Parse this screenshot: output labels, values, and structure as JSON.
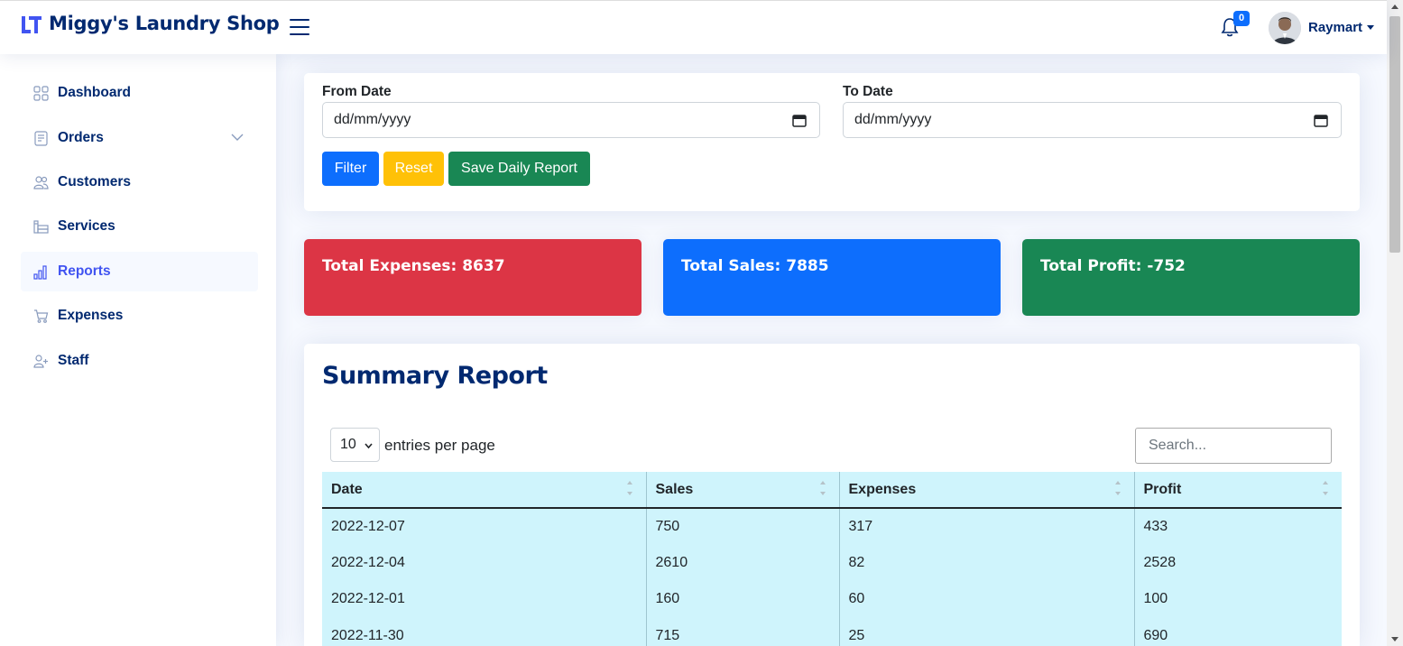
{
  "header": {
    "brand": "Miggy's Laundry Shop",
    "notification_count": "0",
    "user_name": "Raymart"
  },
  "sidebar": {
    "items": [
      {
        "label": "Dashboard",
        "icon": "grid-icon"
      },
      {
        "label": "Orders",
        "icon": "orders-icon"
      },
      {
        "label": "Customers",
        "icon": "customers-icon"
      },
      {
        "label": "Services",
        "icon": "services-icon"
      },
      {
        "label": "Reports",
        "icon": "bar-chart-icon"
      },
      {
        "label": "Expenses",
        "icon": "cart-icon"
      },
      {
        "label": "Staff",
        "icon": "person-add-icon"
      }
    ]
  },
  "filter": {
    "from_label": "From Date",
    "from_value": "dd/mm/yyyy",
    "to_label": "To Date",
    "to_value": "dd/mm/yyyy",
    "filter_btn": "Filter",
    "reset_btn": "Reset",
    "save_btn": "Save Daily Report"
  },
  "stats": {
    "expenses": "Total Expenses: 8637",
    "sales": "Total Sales: 7885",
    "profit": "Total Profit: -752"
  },
  "report": {
    "title": "Summary Report",
    "per_page_value": "10",
    "per_page_text": "entries per page",
    "search_placeholder": "Search...",
    "columns": [
      "Date",
      "Sales",
      "Expenses",
      "Profit"
    ],
    "rows": [
      [
        "2022-12-07",
        "750",
        "317",
        "433"
      ],
      [
        "2022-12-04",
        "2610",
        "82",
        "2528"
      ],
      [
        "2022-12-01",
        "160",
        "60",
        "100"
      ],
      [
        "2022-11-30",
        "715",
        "25",
        "690"
      ]
    ]
  },
  "colors": {
    "expenses": "#dc3545",
    "sales": "#0d6efd",
    "profit": "#198754",
    "navy": "#012970"
  }
}
